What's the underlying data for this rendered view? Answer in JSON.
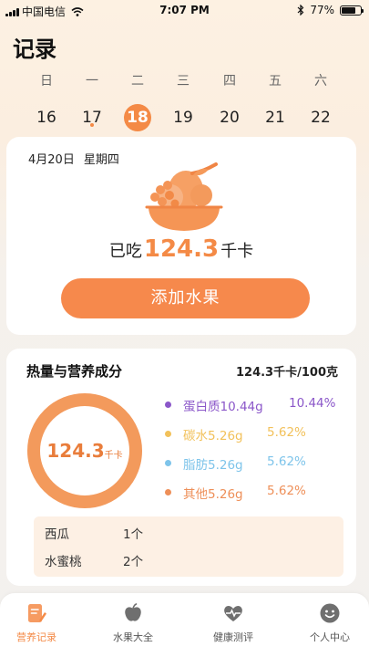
{
  "status_bar": {
    "carrier": "中国电信",
    "time": "7:07 PM",
    "battery": "77%",
    "battery_level": 0.77
  },
  "header": {
    "title": "记录"
  },
  "week": {
    "weekdays": [
      "日",
      "一",
      "二",
      "三",
      "四",
      "五",
      "六"
    ],
    "dates": [
      "16",
      "17",
      "18",
      "19",
      "20",
      "21",
      "22"
    ],
    "selected_index": 2,
    "dot_index": 1
  },
  "summary": {
    "date": "4月20日",
    "weekday": "星期四",
    "eaten_prefix": "已吃",
    "calories": "124.3",
    "unit": "千卡",
    "add_button": "添加水果"
  },
  "nutrition": {
    "title": "热量与营养成分",
    "total": "124.3千卡/100克",
    "ring_value": "124.3",
    "ring_unit": "千卡",
    "ring_color": "#f39a5c",
    "items": [
      {
        "name": "蛋白质10.44g",
        "percent": "10.44%",
        "color": "#8b57c9"
      },
      {
        "name": "碳水5.26g",
        "percent": "5.62%",
        "color": "#f2c15a"
      },
      {
        "name": "脂肪5.26g",
        "percent": "5.62%",
        "color": "#7ec4ea"
      },
      {
        "name": "其他5.26g",
        "percent": "5.62%",
        "color": "#ee8f58"
      }
    ],
    "fruits": [
      {
        "name": "西瓜",
        "qty": "1个"
      },
      {
        "name": "水蜜桃",
        "qty": "2个"
      }
    ]
  },
  "tabbar": {
    "accent": "#f48a46",
    "tabs": [
      {
        "label": "营养记录",
        "icon": "notebook-pencil-icon",
        "active": true
      },
      {
        "label": "水果大全",
        "icon": "apple-icon",
        "active": false
      },
      {
        "label": "健康测评",
        "icon": "heartbeat-icon",
        "active": false
      },
      {
        "label": "个人中心",
        "icon": "smiley-face-icon",
        "active": false
      }
    ]
  }
}
